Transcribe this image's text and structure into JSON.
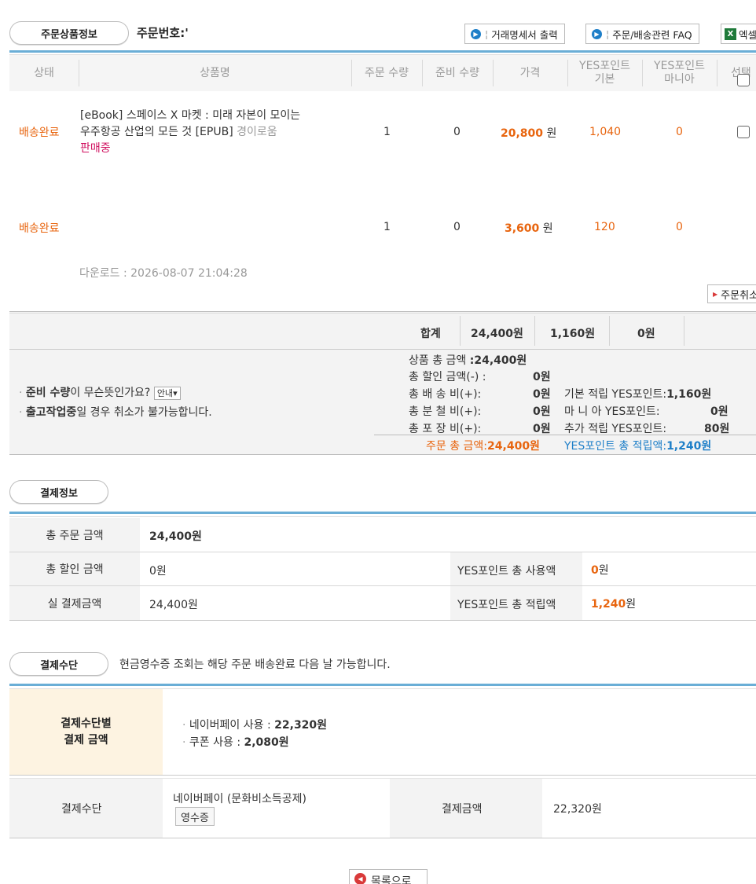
{
  "order_header": {
    "tab_label": "주문상품정보",
    "order_no_label": "주문번호:'",
    "btn_invoice": "거래명세서 출력",
    "btn_faq": "주문/배송관련 FAQ",
    "btn_excel": "엑셀"
  },
  "table_headers": {
    "status": "상태",
    "product": "상품명",
    "order_qty": "주문 수량",
    "prep_qty": "준비 수량",
    "price": "가격",
    "yes_basic_1": "YES포인트",
    "yes_basic_2": "기본",
    "yes_mania_1": "YES포인트",
    "yes_mania_2": "마니아",
    "select": "선택"
  },
  "rows": [
    {
      "status": "배송완료",
      "title_line1": "[eBook] 스페이스 X 마켓 : 미래 자본이 모이는",
      "title_line2": "우주항공 산업의 모든 것 [EPUB]",
      "publisher": "경이로움",
      "sale_status": "판매중",
      "order_qty": "1",
      "prep_qty": "0",
      "price": "20,800",
      "won": "원",
      "yes_basic": "1,040",
      "yes_mania": "0"
    },
    {
      "status": "배송완료",
      "order_qty": "1",
      "prep_qty": "0",
      "price": "3,600",
      "won": "원",
      "yes_basic": "120",
      "yes_mania": "0"
    }
  ],
  "download_text": "다운로드 : 2026-08-07 21:04:28",
  "cancel_btn": "주문취소",
  "summary": {
    "total_label": "합계",
    "total_amount": "24,400원",
    "total_yes": "1,160원",
    "total_mania": "0원"
  },
  "notes": {
    "note1_prefix": "준비 수량",
    "note1_suffix": "이 무슨뜻인가요?",
    "note1_btn": "안내",
    "note2_prefix": "출고작업중",
    "note2_suffix": "일 경우 취소가 불가능합니다."
  },
  "details": {
    "product_total_label": "상품 총 금액",
    "product_total": ":24,400원",
    "discount_label": "총 할인 금액(-) :",
    "discount": "0원",
    "shipping_label": "총 배 송 비(+):",
    "shipping": "0원",
    "installment_label": "총 분 철 비(+):",
    "installment": "0원",
    "wrapping_label": "총 포 장 비(+):",
    "wrapping": "0원",
    "basic_yes_label": "기본 적립 YES포인트:",
    "basic_yes": "1,160원",
    "mania_yes_label": "마 니 아 YES포인트:",
    "mania_yes": "0원",
    "extra_yes_label": "추가 적립 YES포인트:",
    "extra_yes": "80원",
    "order_total_label": "주문 총 금액:",
    "order_total": "24,400원",
    "yes_total_label": "YES포인트 총 적립액:",
    "yes_total": "1,240원"
  },
  "payment_info": {
    "tab_label": "결제정보",
    "total_order_label": "총 주문 금액",
    "total_order": "24,400원",
    "total_discount_label": "총 할인 금액",
    "total_discount": "0원",
    "yes_used_label": "YES포인트 총 사용액",
    "yes_used_num": "0",
    "yes_used_unit": "원",
    "actual_label": "실 결제금액",
    "actual": "24,400원",
    "yes_earned_label": "YES포인트 총 적립액",
    "yes_earned_num": "1,240",
    "yes_earned_unit": "원"
  },
  "payment_method": {
    "tab_label": "결제수단",
    "notice": "현금영수증 조회는 해당 주문 배송완료 다음 날 가능합니다.",
    "by_method_label_1": "결제수단별",
    "by_method_label_2": "결제 금액",
    "naverpay_label": "네이버페이 사용 :",
    "naverpay": "22,320원",
    "coupon_label": "쿠폰 사용 :",
    "coupon": "2,080원",
    "method_label": "결제수단",
    "method_value": "네이버페이 (문화비소득공제)",
    "receipt_btn": "영수증",
    "amount_label": "결제금액",
    "amount_value": "22,320원"
  },
  "bottom_btn": "목록으로"
}
